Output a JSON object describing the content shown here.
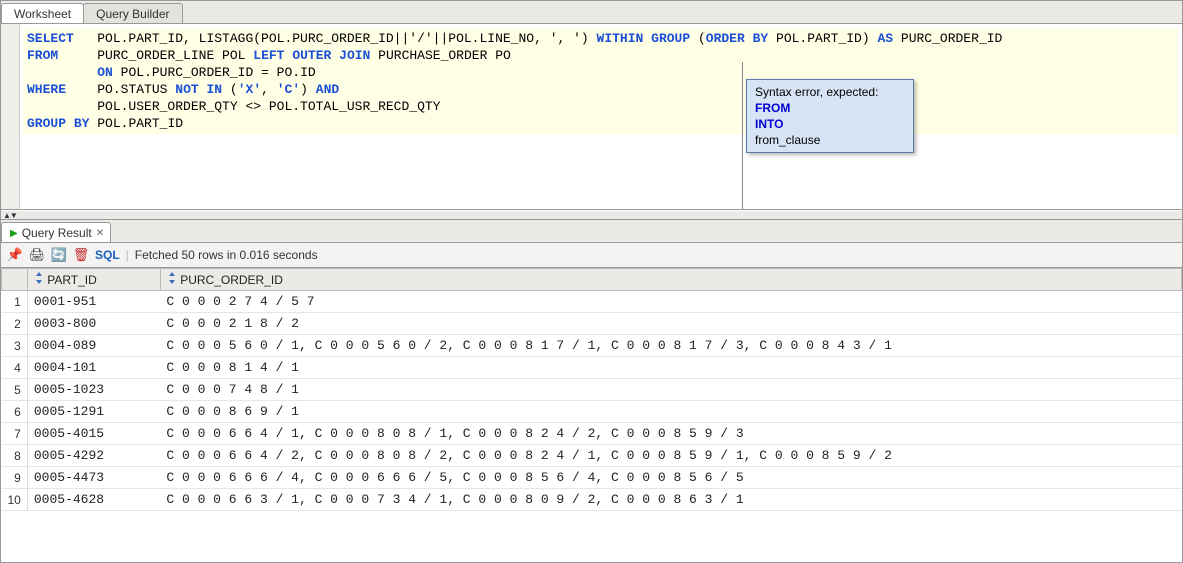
{
  "tabs": [
    "Worksheet",
    "Query Builder"
  ],
  "sql": {
    "line1": {
      "select": "SELECT",
      "cols": "POL.PART_ID, LISTAGG(POL.PURC_ORDER_ID||'/'||POL.LINE_NO, ', ')",
      "within": "WITHIN",
      "group": "GROUP",
      "paren_open": "(",
      "order": "ORDER",
      "by": "BY",
      "order_col": "POL.PART_ID)",
      "as": "AS",
      "alias": "PURC_ORDER_ID"
    },
    "line2": {
      "from": "FROM",
      "tbl1": "PURC_ORDER_LINE POL",
      "left": "LEFT",
      "outer": "OUTER",
      "join": "JOIN",
      "tbl2": "PURCHASE_ORDER PO"
    },
    "line3": {
      "on": "ON",
      "cond": "POL.PURC_ORDER_ID = PO.ID"
    },
    "line4": {
      "where": "WHERE",
      "col": "PO.STATUS",
      "not": "NOT",
      "in": "IN",
      "lparen": "(",
      "v1": "'X'",
      "comma": ",",
      "v2": "'C'",
      "rparen": ")",
      "and": "AND"
    },
    "line5": "POL.USER_ORDER_QTY <> POL.TOTAL_USR_RECD_QTY",
    "line6": {
      "group": "GROUP",
      "by": "BY",
      "col": "POL.PART_ID"
    }
  },
  "tooltip": {
    "title": "Syntax error, expected:",
    "opts": [
      "FROM",
      "INTO",
      "from_clause"
    ]
  },
  "result": {
    "tab": "Query Result",
    "sql_label": "SQL",
    "status": "Fetched 50 rows in 0.016 seconds",
    "columns": [
      "PART_ID",
      "PURC_ORDER_ID"
    ],
    "rows": [
      {
        "n": 1,
        "part": "0001-951",
        "order": "C 0 0 0 2 7 4 / 5 7"
      },
      {
        "n": 2,
        "part": "0003-800",
        "order": "C 0 0 0 2 1 8 / 2"
      },
      {
        "n": 3,
        "part": "0004-089",
        "order": "C 0 0 0 5 6 0 / 1,  C 0 0 0 5 6 0 / 2,  C 0 0 0 8 1 7 / 1,  C 0 0 0 8 1 7 / 3,  C 0 0 0 8 4 3 / 1"
      },
      {
        "n": 4,
        "part": "0004-101",
        "order": "C 0 0 0 8 1 4 / 1"
      },
      {
        "n": 5,
        "part": "0005-1023",
        "order": "C 0 0 0 7 4 8 / 1"
      },
      {
        "n": 6,
        "part": "0005-1291",
        "order": "C 0 0 0 8 6 9 / 1"
      },
      {
        "n": 7,
        "part": "0005-4015",
        "order": "C 0 0 0 6 6 4 / 1,  C 0 0 0 8 0 8 / 1,  C 0 0 0 8 2 4 / 2,  C 0 0 0 8 5 9 / 3"
      },
      {
        "n": 8,
        "part": "0005-4292",
        "order": "C 0 0 0 6 6 4 / 2,  C 0 0 0 8 0 8 / 2,  C 0 0 0 8 2 4 / 1,  C 0 0 0 8 5 9 / 1,  C 0 0 0 8 5 9 / 2"
      },
      {
        "n": 9,
        "part": "0005-4473",
        "order": "C 0 0 0 6 6 6 / 4,  C 0 0 0 6 6 6 / 5,  C 0 0 0 8 5 6 / 4,  C 0 0 0 8 5 6 / 5"
      },
      {
        "n": 10,
        "part": "0005-4628",
        "order": "C 0 0 0 6 6 3 / 1,  C 0 0 0 7 3 4 / 1,  C 0 0 0 8 0 9 / 2,  C 0 0 0 8 6 3 / 1"
      }
    ]
  }
}
